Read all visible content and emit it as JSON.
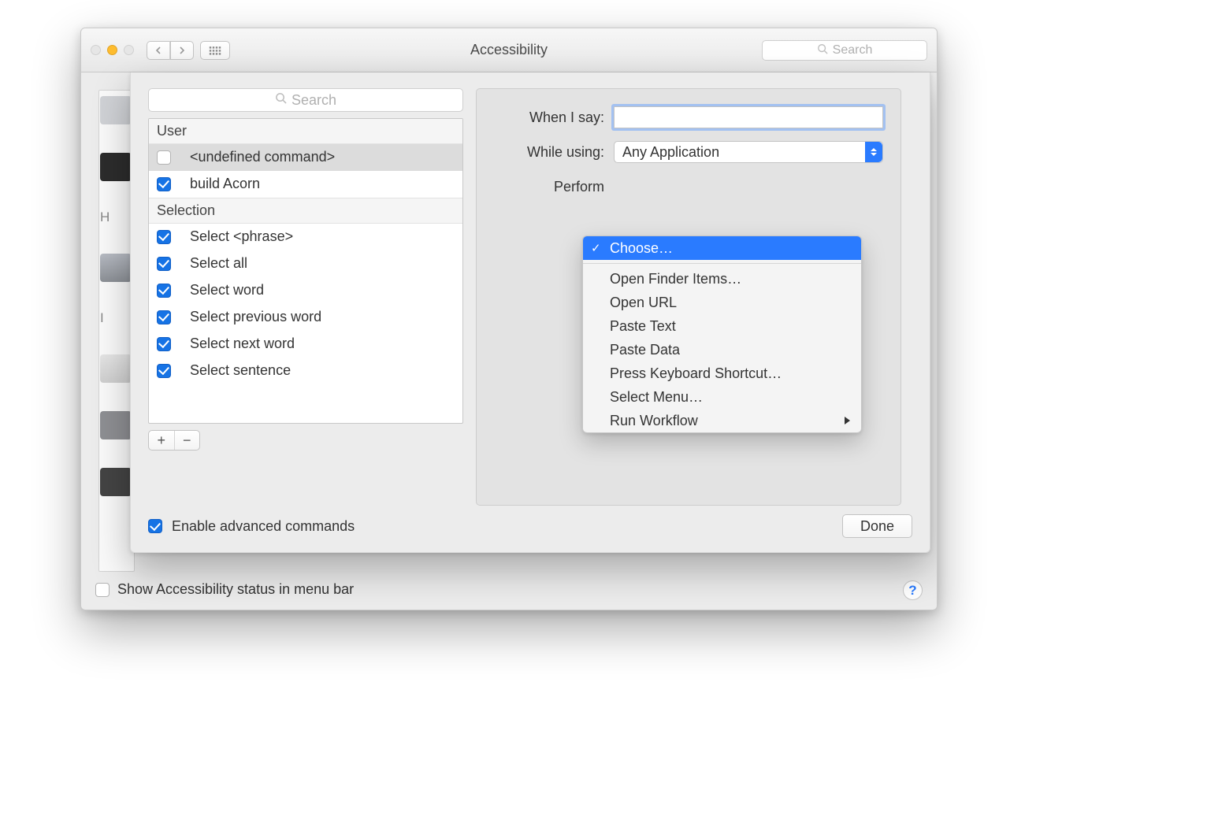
{
  "window": {
    "title": "Accessibility",
    "search_placeholder": "Search"
  },
  "sidebar_peek_labels": [
    "H",
    "I"
  ],
  "footer": {
    "accessibility_status_label": "Show Accessibility status in menu bar",
    "help_tooltip": "?"
  },
  "sheet": {
    "left": {
      "search_placeholder": "Search",
      "sections": [
        {
          "header": "User",
          "items": [
            {
              "label": "<undefined command>",
              "checked": false,
              "selected": true
            },
            {
              "label": "build Acorn",
              "checked": true,
              "selected": false
            }
          ]
        },
        {
          "header": "Selection",
          "items": [
            {
              "label": "Select <phrase>",
              "checked": true,
              "selected": false
            },
            {
              "label": "Select all",
              "checked": true,
              "selected": false
            },
            {
              "label": "Select word",
              "checked": true,
              "selected": false
            },
            {
              "label": "Select previous word",
              "checked": true,
              "selected": false
            },
            {
              "label": "Select next word",
              "checked": true,
              "selected": false
            },
            {
              "label": "Select sentence",
              "checked": true,
              "selected": false
            }
          ]
        }
      ],
      "add_label": "+",
      "remove_label": "−"
    },
    "right": {
      "when_i_say_label": "When I say:",
      "when_i_say_value": "",
      "while_using_label": "While using:",
      "while_using_value": "Any Application",
      "perform_label": "Perform"
    },
    "enable_advanced_label": "Enable advanced commands",
    "done_label": "Done"
  },
  "dropdown": {
    "selected": "Choose…",
    "groups": [
      [
        "Choose…"
      ],
      [
        "Open Finder Items…",
        "Open URL",
        "Paste Text",
        "Paste Data",
        "Press Keyboard Shortcut…",
        "Select Menu…",
        "Run Workflow"
      ]
    ],
    "submenu_item": "Run Workflow"
  }
}
